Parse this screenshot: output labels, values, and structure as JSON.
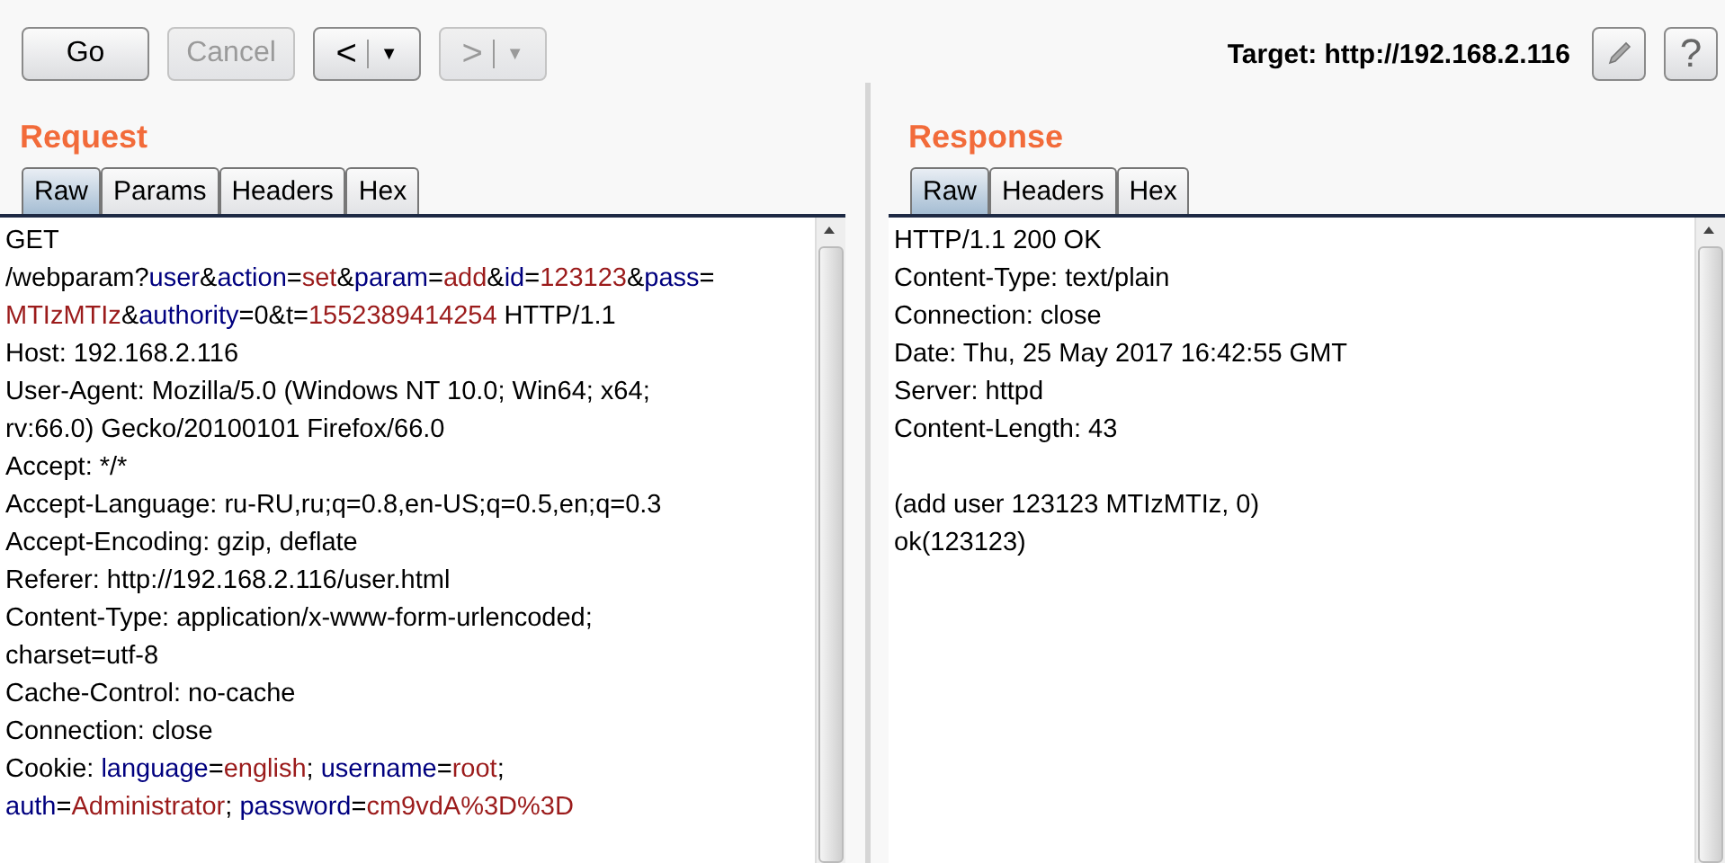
{
  "toolbar": {
    "buttons": [
      {
        "kind": "text",
        "label": "Go",
        "disabled": false
      },
      {
        "kind": "text",
        "label": "Cancel",
        "disabled": true
      },
      {
        "kind": "split",
        "label": "<",
        "caret": "▼",
        "disabled": false
      },
      {
        "kind": "split",
        "label": ">",
        "caret": "▼",
        "disabled": true
      }
    ],
    "target": "Target: http://192.168.2.116",
    "help_button": "?"
  },
  "panes": [
    {
      "title": "Request",
      "tabs": [
        {
          "label": "Raw",
          "selected": true
        },
        {
          "label": "Params",
          "selected": false
        },
        {
          "label": "Headers",
          "selected": false
        },
        {
          "label": "Hex",
          "selected": false
        }
      ],
      "lines": [
        [
          {
            "text": "GET",
            "kind": "plain"
          }
        ],
        [
          {
            "text": "/webparam?",
            "kind": "plain"
          },
          {
            "text": "user",
            "kind": "name"
          },
          {
            "text": "&",
            "kind": "plain"
          },
          {
            "text": "action",
            "kind": "name"
          },
          {
            "text": "=",
            "kind": "plain"
          },
          {
            "text": "set",
            "kind": "value"
          },
          {
            "text": "&",
            "kind": "plain"
          },
          {
            "text": "param",
            "kind": "name"
          },
          {
            "text": "=",
            "kind": "plain"
          },
          {
            "text": "add",
            "kind": "value"
          },
          {
            "text": "&",
            "kind": "plain"
          },
          {
            "text": "id",
            "kind": "name"
          },
          {
            "text": "=",
            "kind": "plain"
          },
          {
            "text": "123123",
            "kind": "value"
          },
          {
            "text": "&",
            "kind": "plain"
          },
          {
            "text": "pass",
            "kind": "name"
          },
          {
            "text": "=",
            "kind": "plain"
          }
        ],
        [
          {
            "text": "MTIzMTIz",
            "kind": "value"
          },
          {
            "text": "&",
            "kind": "plain"
          },
          {
            "text": "authority",
            "kind": "name"
          },
          {
            "text": "=0&t=",
            "kind": "plain"
          },
          {
            "text": "1552389414254",
            "kind": "value"
          },
          {
            "text": " HTTP/1.1",
            "kind": "plain"
          }
        ],
        [
          {
            "text": "Host: 192.168.2.116",
            "kind": "plain"
          }
        ],
        [
          {
            "text": "User-Agent: Mozilla/5.0 (Windows NT 10.0; Win64; x64;",
            "kind": "plain"
          }
        ],
        [
          {
            "text": "rv:66.0) Gecko/20100101 Firefox/66.0",
            "kind": "plain"
          }
        ],
        [
          {
            "text": "Accept: */*",
            "kind": "plain"
          }
        ],
        [
          {
            "text": "Accept-Language: ru-RU,ru;q=0.8,en-US;q=0.5,en;q=0.3",
            "kind": "plain"
          }
        ],
        [
          {
            "text": "Accept-Encoding: gzip, deflate",
            "kind": "plain"
          }
        ],
        [
          {
            "text": "Referer: http://192.168.2.116/user.html",
            "kind": "plain"
          }
        ],
        [
          {
            "text": "Content-Type: application/x-www-form-urlencoded;",
            "kind": "plain"
          }
        ],
        [
          {
            "text": "charset=utf-8",
            "kind": "plain"
          }
        ],
        [
          {
            "text": "Cache-Control: no-cache",
            "kind": "plain"
          }
        ],
        [
          {
            "text": "Connection: close",
            "kind": "plain"
          }
        ],
        [
          {
            "text": "Cookie: ",
            "kind": "plain"
          },
          {
            "text": "language",
            "kind": "name"
          },
          {
            "text": "=",
            "kind": "plain"
          },
          {
            "text": "english",
            "kind": "value"
          },
          {
            "text": "; ",
            "kind": "plain"
          },
          {
            "text": "username",
            "kind": "name"
          },
          {
            "text": "=",
            "kind": "plain"
          },
          {
            "text": "root",
            "kind": "value"
          },
          {
            "text": ";",
            "kind": "plain"
          }
        ],
        [
          {
            "text": "auth",
            "kind": "name"
          },
          {
            "text": "=",
            "kind": "plain"
          },
          {
            "text": "Administrator",
            "kind": "value"
          },
          {
            "text": "; ",
            "kind": "plain"
          },
          {
            "text": "password",
            "kind": "name"
          },
          {
            "text": "=",
            "kind": "plain"
          },
          {
            "text": "cm9vdA%3D%3D",
            "kind": "value"
          }
        ]
      ]
    },
    {
      "title": "Response",
      "tabs": [
        {
          "label": "Raw",
          "selected": true
        },
        {
          "label": "Headers",
          "selected": false
        },
        {
          "label": "Hex",
          "selected": false
        }
      ],
      "lines": [
        [
          {
            "text": "HTTP/1.1 200 OK",
            "kind": "plain"
          }
        ],
        [
          {
            "text": "Content-Type: text/plain",
            "kind": "plain"
          }
        ],
        [
          {
            "text": "Connection: close",
            "kind": "plain"
          }
        ],
        [
          {
            "text": "Date: Thu, 25 May 2017 16:42:55 GMT",
            "kind": "plain"
          }
        ],
        [
          {
            "text": "Server: httpd",
            "kind": "plain"
          }
        ],
        [
          {
            "text": "Content-Length: 43",
            "kind": "plain"
          }
        ]
      ],
      "body_lines": [
        [
          {
            "text": "(add user 123123 MTIzMTIz, 0)",
            "kind": "plain"
          }
        ],
        [
          {
            "text": "ok(123123)",
            "kind": "plain"
          }
        ]
      ]
    }
  ]
}
